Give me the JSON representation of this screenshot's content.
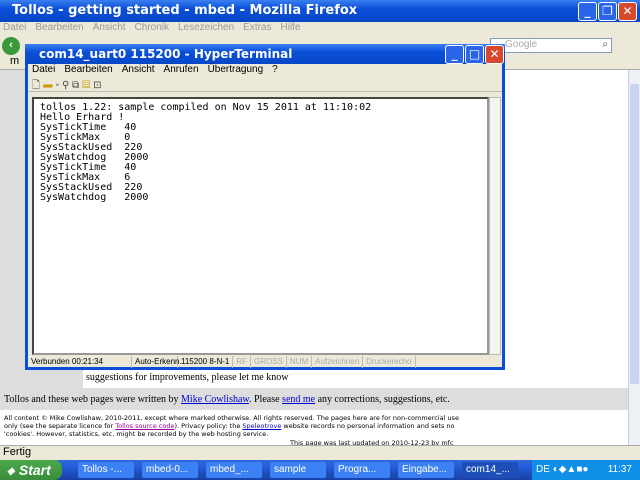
{
  "firefox": {
    "title": "Tollos - getting started - mbed - Mozilla Firefox",
    "menu": [
      "Datei",
      "Bearbeiten",
      "Ansicht",
      "Chronik",
      "Lesezeichen",
      "Extras",
      "Hilfe"
    ],
    "search_placeholder": "Google",
    "tab_label": "m",
    "status": "Fertig"
  },
  "page": {
    "suggestions": "suggestions for improvements, please let me know",
    "credit_pre": "Tollos and these web pages were written by ",
    "credit_link": "Mike Cowlishaw",
    "credit_mid": ". Please ",
    "credit_link2": "send me",
    "credit_post": " any corrections, suggestions, etc.",
    "footer1": "All content © Mike Cowlishaw, 2010-2011, except where marked otherwise. All rights reserved. The pages here are for non-commercial use",
    "footer2_pre": "only (see the separate licence for ",
    "footer2_link": "Tollos source code",
    "footer2_mid": "). Privacy policy: the ",
    "footer2_link2": "Speleotrove",
    "footer2_post": " website records no personal information and sets no",
    "footer3": "'cookies'. However, statistics, etc. might be recorded by the web hosting service.",
    "updated": "This page was last updated on 2010-12-23 by mfc"
  },
  "hyperterminal": {
    "title": "com14_uart0  115200 - HyperTerminal",
    "menu": [
      "Datei",
      "Bearbeiten",
      "Ansicht",
      "Anrufen",
      "Übertragung",
      "?"
    ],
    "output": "tollos 1.22: sample compiled on Nov 15 2011 at 11:10:02\nHello Erhard !\nSysTickTime   40\nSysTickMax    0\nSysStackUsed  220\nSysWatchdog   2000\nSysTickTime   40\nSysTickMax    6\nSysStackUsed  220\nSysWatchdog   2000",
    "status": [
      "Verbunden 00:21:34",
      "Auto-Erkenn.",
      "115200 8-N-1",
      "RF",
      "GROSS",
      "NUM",
      "Aufzeichnen",
      "Druckerecho"
    ]
  },
  "taskbar": {
    "start": "Start",
    "tasks": [
      "Tollos -...",
      "mbed-0...",
      "mbed_...",
      "sample",
      "Progra...",
      "Eingabe...",
      "com14_..."
    ],
    "lang": "DE",
    "clock": "11:37"
  }
}
